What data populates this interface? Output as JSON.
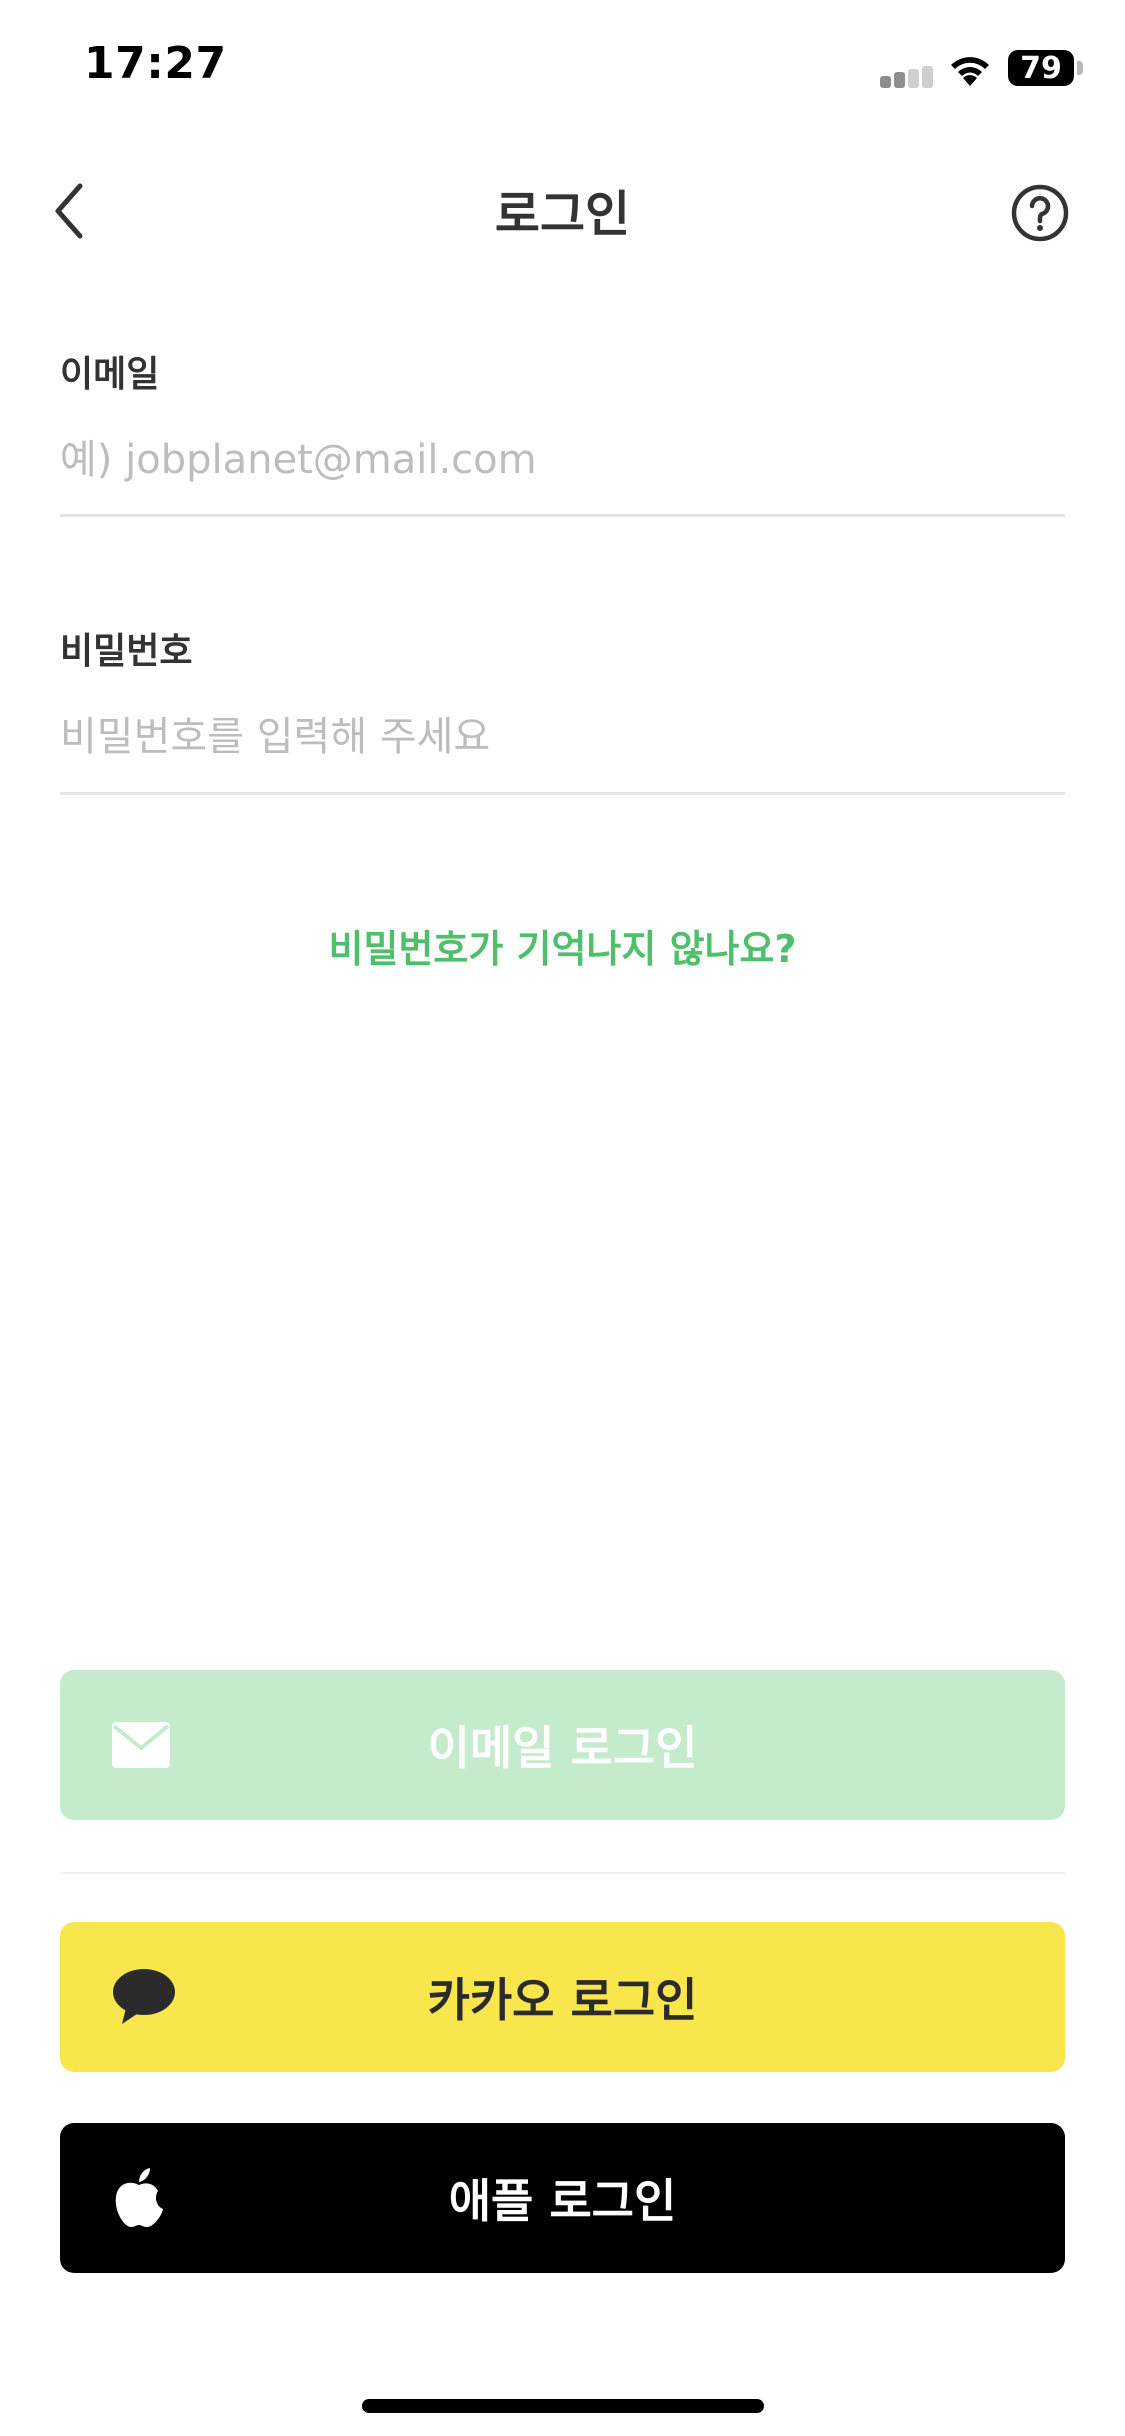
{
  "status_bar": {
    "time": "17:27",
    "battery_level": "79",
    "signal_bars_active": 2,
    "signal_bars_total": 4
  },
  "nav": {
    "title": "로그인",
    "back_icon": "chevron-left-icon",
    "help_icon": "question-circle-icon"
  },
  "form": {
    "email": {
      "label": "이메일",
      "value": "",
      "placeholder": "예) jobplanet@mail.com"
    },
    "password": {
      "label": "비밀번호",
      "value": "",
      "placeholder": "비밀번호를 입력해 주세요"
    },
    "forgot_password": "비밀번호가 기억나지 않나요?"
  },
  "buttons": {
    "email_login": {
      "label": "이메일 로그인",
      "icon": "mail-icon",
      "enabled": false
    },
    "kakao_login": {
      "label": "카카오 로그인",
      "icon": "speech-bubble-icon"
    },
    "apple_login": {
      "label": "애플 로그인",
      "icon": "apple-icon"
    }
  },
  "colors": {
    "accent_green": "#4fbf6b",
    "email_button_disabled": "#c4ebcb",
    "kakao_yellow": "#f9e64d",
    "apple_black": "#000000"
  }
}
